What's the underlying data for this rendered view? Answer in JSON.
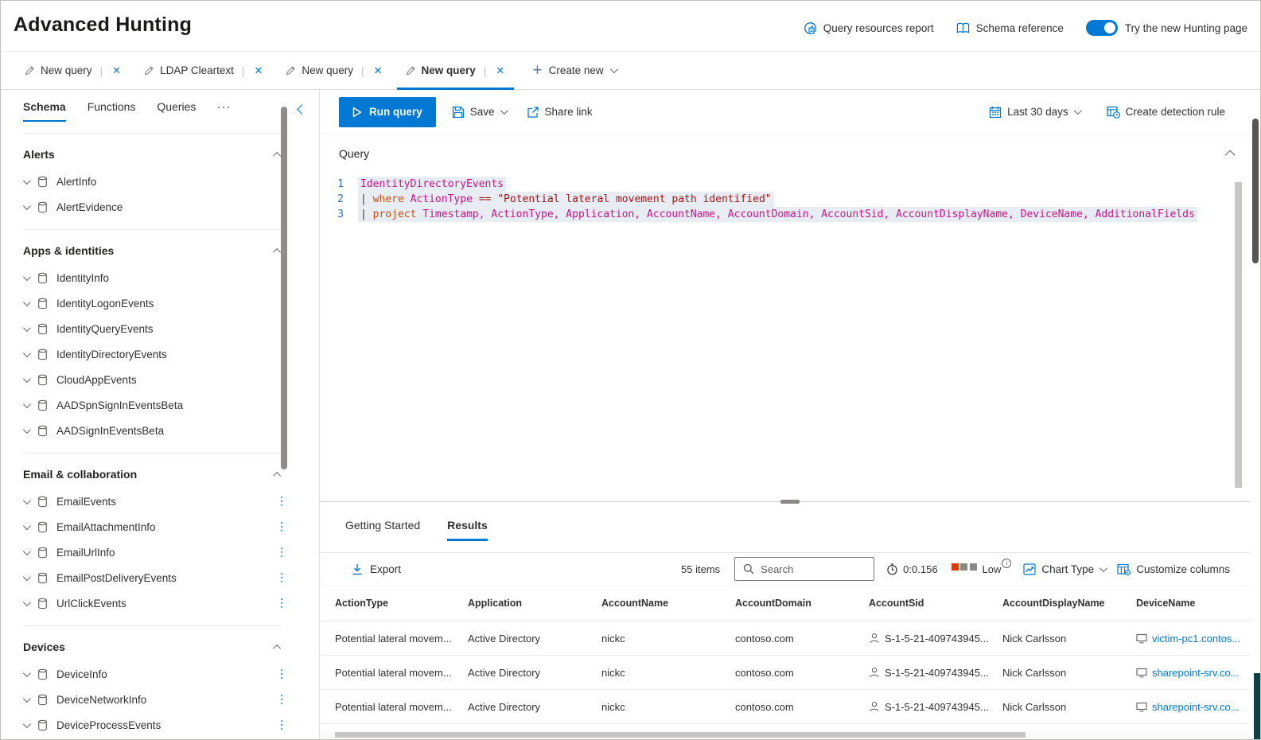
{
  "header": {
    "title": "Advanced Hunting",
    "query_resources_report": "Query resources report",
    "schema_reference": "Schema reference",
    "toggle_label": "Try the new Hunting page",
    "toggle_state": "on"
  },
  "tabs": {
    "items": [
      {
        "label": "New query",
        "active": false
      },
      {
        "label": "LDAP Cleartext",
        "active": false
      },
      {
        "label": "New query",
        "active": false
      },
      {
        "label": "New query",
        "active": true
      }
    ],
    "create_new": "Create new"
  },
  "sidebar": {
    "tabs": [
      {
        "label": "Schema",
        "active": true
      },
      {
        "label": "Functions",
        "active": false
      },
      {
        "label": "Queries",
        "active": false
      }
    ],
    "overflow_glyph": "···",
    "sections": [
      {
        "title": "Alerts",
        "items": [
          "AlertInfo",
          "AlertEvidence"
        ]
      },
      {
        "title": "Apps & identities",
        "items": [
          "IdentityInfo",
          "IdentityLogonEvents",
          "IdentityQueryEvents",
          "IdentityDirectoryEvents",
          "CloudAppEvents",
          "AADSpnSignInEventsBeta",
          "AADSignInEventsBeta"
        ]
      },
      {
        "title": "Email & collaboration",
        "items": [
          "EmailEvents",
          "EmailAttachmentInfo",
          "EmailUrlInfo",
          "EmailPostDeliveryEvents",
          "UrlClickEvents"
        ]
      },
      {
        "title": "Devices",
        "items": [
          "DeviceInfo",
          "DeviceNetworkInfo",
          "DeviceProcessEvents"
        ]
      }
    ]
  },
  "toolbar": {
    "run_query": "Run query",
    "save": "Save",
    "share_link": "Share link",
    "time_range": "Last 30 days",
    "create_detection_rule": "Create detection rule"
  },
  "query": {
    "label": "Query",
    "lines": [
      [
        {
          "t": "table",
          "v": "IdentityDirectoryEvents"
        }
      ],
      [
        {
          "t": "plain",
          "v": "| "
        },
        {
          "t": "keyword",
          "v": "where"
        },
        {
          "t": "plain",
          "v": " "
        },
        {
          "t": "column",
          "v": "ActionType"
        },
        {
          "t": "plain",
          "v": " "
        },
        {
          "t": "operator",
          "v": "== "
        },
        {
          "t": "string",
          "v": "\"Potential lateral movement path identified\""
        }
      ],
      [
        {
          "t": "plain",
          "v": "| "
        },
        {
          "t": "keyword",
          "v": "project"
        },
        {
          "t": "plain",
          "v": " "
        },
        {
          "t": "column",
          "v": "Timestamp, ActionType, Application, AccountName, AccountDomain, AccountSid, AccountDisplayName, DeviceName, AdditionalFields"
        }
      ]
    ]
  },
  "results": {
    "tabs": [
      {
        "label": "Getting Started",
        "active": false
      },
      {
        "label": "Results",
        "active": true
      }
    ],
    "export_label": "Export",
    "items_count": "55 items",
    "search_placeholder": "Search",
    "duration": "0:0.156",
    "resource_level": "Low",
    "chart_type": "Chart Type",
    "customize_columns": "Customize columns",
    "columns": [
      "ActionType",
      "Application",
      "AccountName",
      "AccountDomain",
      "AccountSid",
      "AccountDisplayName",
      "DeviceName"
    ],
    "rows": [
      {
        "ActionType": "Potential lateral movem...",
        "Application": "Active Directory",
        "AccountName": "nickc",
        "AccountDomain": "contoso.com",
        "AccountSid": "S-1-5-21-409743945...",
        "AccountDisplayName": "Nick Carlsson",
        "DeviceName": "victim-pc1.contos..."
      },
      {
        "ActionType": "Potential lateral movem...",
        "Application": "Active Directory",
        "AccountName": "nickc",
        "AccountDomain": "contoso.com",
        "AccountSid": "S-1-5-21-409743945...",
        "AccountDisplayName": "Nick Carlsson",
        "DeviceName": "sharepoint-srv.co..."
      },
      {
        "ActionType": "Potential lateral movem...",
        "Application": "Active Directory",
        "AccountName": "nickc",
        "AccountDomain": "contoso.com",
        "AccountSid": "S-1-5-21-409743945...",
        "AccountDisplayName": "Nick Carlsson",
        "DeviceName": "sharepoint-srv.co..."
      }
    ]
  },
  "icons": {
    "close_glyph": "✕",
    "plus_glyph": "+",
    "pipe_glyph": "|"
  },
  "colors": {
    "accent": "#0078d4",
    "resource_squares": [
      "#d83b01",
      "#8a8886",
      "#8a8886"
    ],
    "code": {
      "table": "#c71585",
      "keyword": "#ca5010",
      "column": "#c71585",
      "operator": "#a31515",
      "string": "#a31515",
      "line_number": "#2272b9"
    }
  }
}
